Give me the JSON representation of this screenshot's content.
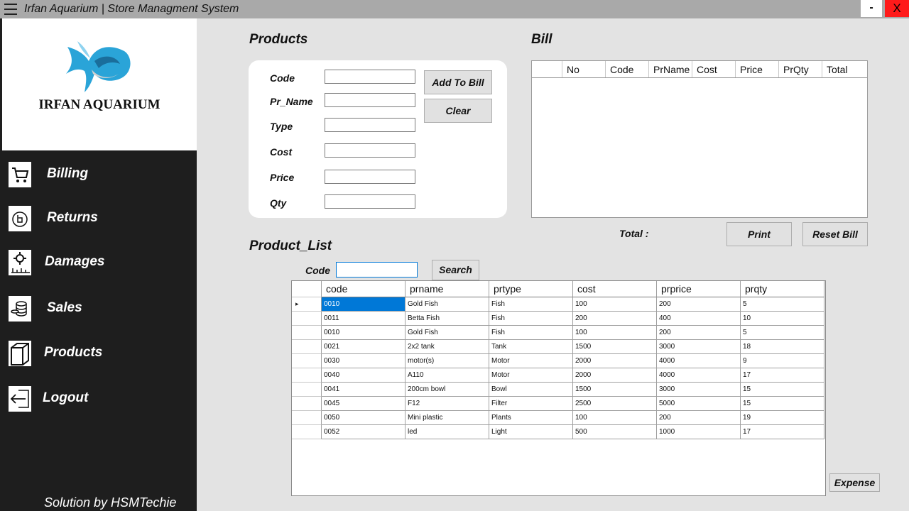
{
  "window": {
    "title": "Irfan Aquarium | Store Managment System",
    "minimize_label": "-",
    "close_label": "X"
  },
  "sidebar": {
    "brand": "IRFAN AQUARIUM",
    "items": [
      {
        "label": "Billing",
        "icon": "cart-icon"
      },
      {
        "label": "Returns",
        "icon": "returns-icon"
      },
      {
        "label": "Damages",
        "icon": "damaged-gear-icon"
      },
      {
        "label": "Sales",
        "icon": "coins-icon"
      },
      {
        "label": "Products",
        "icon": "box-icon"
      },
      {
        "label": "Logout",
        "icon": "logout-arrow-icon"
      }
    ],
    "footer": "Solution by HSMTechie"
  },
  "products": {
    "title": "Products",
    "fields": [
      {
        "label": "Code",
        "value": ""
      },
      {
        "label": "Pr_Name",
        "value": ""
      },
      {
        "label": "Type",
        "value": ""
      },
      {
        "label": "Cost",
        "value": ""
      },
      {
        "label": "Price",
        "value": ""
      },
      {
        "label": "Qty",
        "value": ""
      }
    ],
    "add_to_bill_label": "Add To Bill",
    "clear_label": "Clear"
  },
  "bill": {
    "title": "Bill",
    "columns": [
      "No",
      "Code",
      "PrName",
      "Cost",
      "Price",
      "PrQty",
      "Total"
    ],
    "total_label": "Total :",
    "total_value": "",
    "print_label": "Print",
    "reset_label": "Reset Bill"
  },
  "product_list": {
    "title": "Product_List",
    "search_label": "Code",
    "search_value": "",
    "search_button": "Search",
    "columns": [
      "code",
      "prname",
      "prtype",
      "cost",
      "prprice",
      "prqty"
    ],
    "rows": [
      [
        "0010",
        "Gold Fish",
        "Fish",
        "100",
        "200",
        "5"
      ],
      [
        "0011",
        "Betta Fish",
        "Fish",
        "200",
        "400",
        "10"
      ],
      [
        "0010",
        "Gold Fish",
        "Fish",
        "100",
        "200",
        "5"
      ],
      [
        "0021",
        "2x2 tank",
        "Tank",
        "1500",
        "3000",
        "18"
      ],
      [
        "0030",
        "motor(s)",
        "Motor",
        "2000",
        "4000",
        "9"
      ],
      [
        "0040",
        "A110",
        "Motor",
        "2000",
        "4000",
        "17"
      ],
      [
        "0041",
        "200cm bowl",
        "Bowl",
        "1500",
        "3000",
        "15"
      ],
      [
        "0045",
        "F12",
        "Filter",
        "2500",
        "5000",
        "15"
      ],
      [
        "0050",
        "Mini plastic",
        "Plants",
        "100",
        "200",
        "19"
      ],
      [
        "0052",
        "led",
        "Light",
        "500",
        "1000",
        "17"
      ]
    ],
    "current_row_marker": "▸"
  },
  "expense_label": "Expense",
  "colors": {
    "sidebar_bg": "#1e1e1e",
    "selection": "#0078d7",
    "close_button": "#ff1a1a",
    "logo_blue": "#2aa4d8"
  }
}
